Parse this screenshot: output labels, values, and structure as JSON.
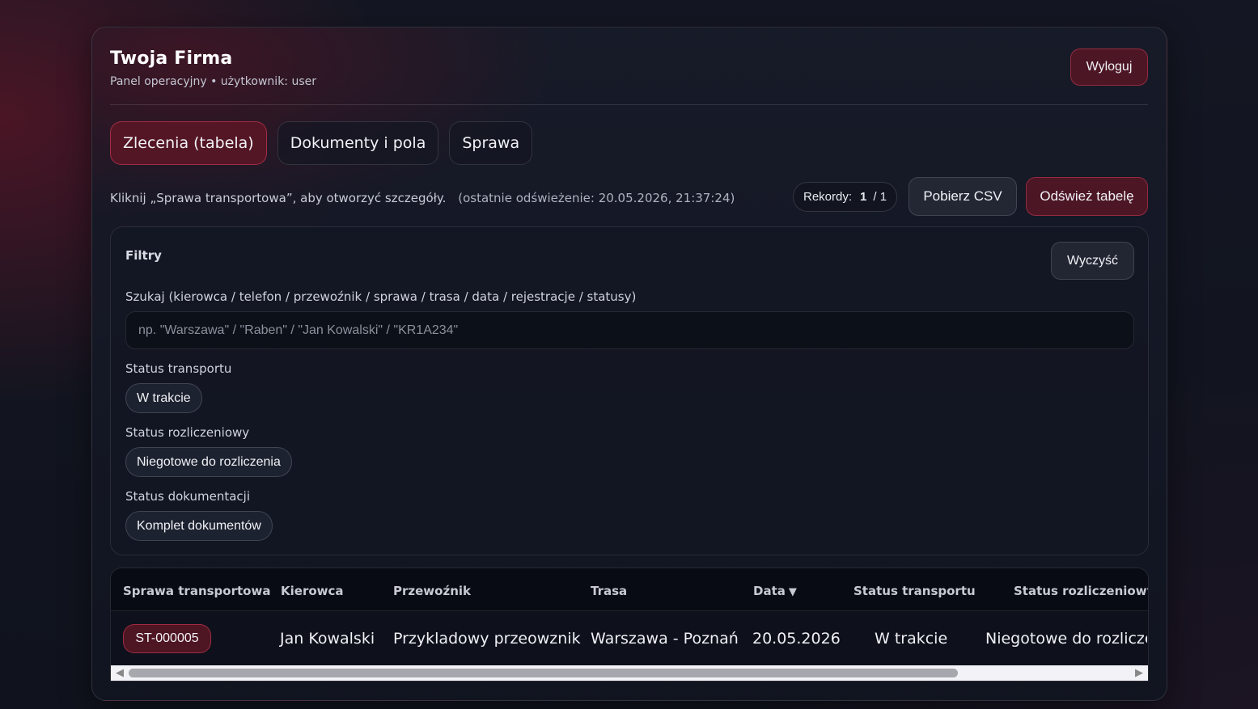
{
  "header": {
    "brand": "Twoja Firma",
    "subtitle": "Panel operacyjny • użytkownik: user",
    "logout_label": "Wyloguj"
  },
  "tabs": [
    {
      "label": "Zlecenia (tabela)",
      "active": true
    },
    {
      "label": "Dokumenty i pola",
      "active": false
    },
    {
      "label": "Sprawa",
      "active": false
    }
  ],
  "toolbar": {
    "info_text": "Kliknij „Sprawa transportowa”, aby otworzyć szczegóły.",
    "refresh_text": "(ostatnie odświeżenie: 20.05.2026, 21:37:24)",
    "records_label": "Rekordy:",
    "records_count": "1",
    "records_total": "/ 1",
    "csv_label": "Pobierz CSV",
    "reload_label": "Odśwież tabelę"
  },
  "filters": {
    "title": "Filtry",
    "clear_label": "Wyczyść",
    "search_label": "Szukaj (kierowca / telefon / przewoźnik / sprawa / trasa / data / rejestracje / statusy)",
    "search_placeholder": "np. \"Warszawa\" / \"Raben\" / \"Jan Kowalski\" / \"KR1A234\"",
    "search_value": "",
    "transport_status_label": "Status transportu",
    "transport_status_chip": "W trakcie",
    "billing_status_label": "Status rozliczeniowy",
    "billing_status_chip": "Niegotowe do rozliczenia",
    "docs_status_label": "Status dokumentacji",
    "docs_status_chip": "Komplet dokumentów"
  },
  "table": {
    "columns": [
      "Sprawa transportowa",
      "Kierowca",
      "Przewoźnik",
      "Trasa",
      "Data",
      "Status transportu",
      "Status rozliczeniowy"
    ],
    "sort_indicator": "▼",
    "rows": [
      {
        "case": "ST-000005",
        "driver": "Jan Kowalski",
        "carrier": "Przykladowy przeowznik",
        "route": "Warszawa - Poznań",
        "date": "20.05.2026",
        "transport_status": "W trakcie",
        "billing_status": "Niegotowe do rozliczenia"
      }
    ]
  },
  "colors": {
    "accent": "#5f1626",
    "accent_border": "#d73c5a",
    "panel_bg": "#181b28"
  }
}
